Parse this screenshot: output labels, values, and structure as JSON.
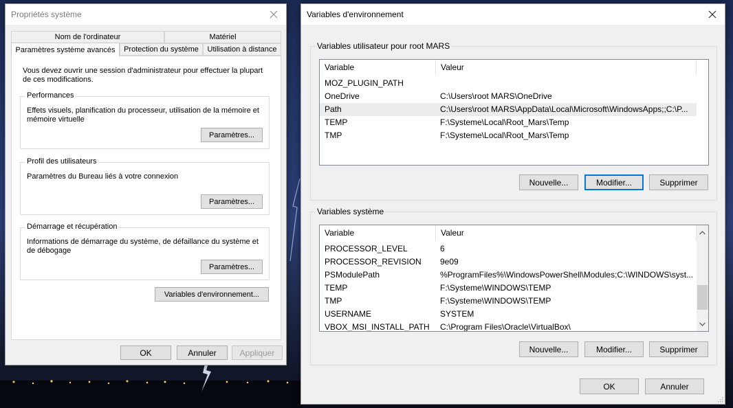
{
  "system_props": {
    "title": "Propriétés système",
    "tabs_row1": [
      "Nom de l'ordinateur",
      "Matériel"
    ],
    "tabs_row2": [
      "Paramètres système avancés",
      "Protection du système",
      "Utilisation à distance"
    ],
    "admin_note": "Vous devez ouvrir une session d'administrateur pour effectuer la plupart de ces modifications.",
    "groups": [
      {
        "label": "Performances",
        "text": "Effets visuels, planification du processeur, utilisation de la mémoire et mémoire virtuelle",
        "button": "Paramètres..."
      },
      {
        "label": "Profil des utilisateurs",
        "text": "Paramètres du Bureau liés à votre connexion",
        "button": "Paramètres..."
      },
      {
        "label": "Démarrage et récupération",
        "text": "Informations de démarrage du système, de défaillance du système et de débogage",
        "button": "Paramètres..."
      }
    ],
    "env_button": "Variables d'environnement...",
    "ok": "OK",
    "cancel": "Annuler",
    "apply": "Appliquer"
  },
  "env_vars": {
    "title": "Variables d'environnement",
    "user_section": {
      "label": "Variables utilisateur pour root MARS",
      "columns": [
        "Variable",
        "Valeur"
      ],
      "rows": [
        {
          "var": "MOZ_PLUGIN_PATH",
          "val": ""
        },
        {
          "var": "OneDrive",
          "val": "C:\\Users\\root MARS\\OneDrive"
        },
        {
          "var": "Path",
          "val": "C:\\Users\\root MARS\\AppData\\Local\\Microsoft\\WindowsApps;;C:\\P..."
        },
        {
          "var": "TEMP",
          "val": "F:\\Systeme\\Local\\Root_Mars\\Temp"
        },
        {
          "var": "TMP",
          "val": "F:\\Systeme\\Local\\Root_Mars\\Temp"
        }
      ],
      "selected_row": 2,
      "buttons": [
        "Nouvelle...",
        "Modifier...",
        "Supprimer"
      ]
    },
    "system_section": {
      "label": "Variables système",
      "columns": [
        "Variable",
        "Valeur"
      ],
      "rows": [
        {
          "var": "PROCESSOR_LEVEL",
          "val": "6"
        },
        {
          "var": "PROCESSOR_REVISION",
          "val": "9e09"
        },
        {
          "var": "PSModulePath",
          "val": "%ProgramFiles%\\WindowsPowerShell\\Modules;C:\\WINDOWS\\syst..."
        },
        {
          "var": "TEMP",
          "val": "F:\\Systeme\\WINDOWS\\TEMP"
        },
        {
          "var": "TMP",
          "val": "F:\\Systeme\\WINDOWS\\TEMP"
        },
        {
          "var": "USERNAME",
          "val": "SYSTEM"
        },
        {
          "var": "VBOX_MSI_INSTALL_PATH",
          "val": "C:\\Program Files\\Oracle\\VirtualBox\\"
        }
      ],
      "buttons": [
        "Nouvelle...",
        "Modifier...",
        "Supprimer"
      ]
    },
    "ok": "OK",
    "cancel": "Annuler"
  },
  "icons": {
    "close": "close-icon",
    "scroll_up": "chevron-up-icon",
    "scroll_down": "chevron-down-icon",
    "resize": "resize-grip-icon"
  },
  "colors": {
    "focus_accent": "#0078d7",
    "window_bg": "#f0f0f0",
    "selection_bg": "#ececec"
  }
}
